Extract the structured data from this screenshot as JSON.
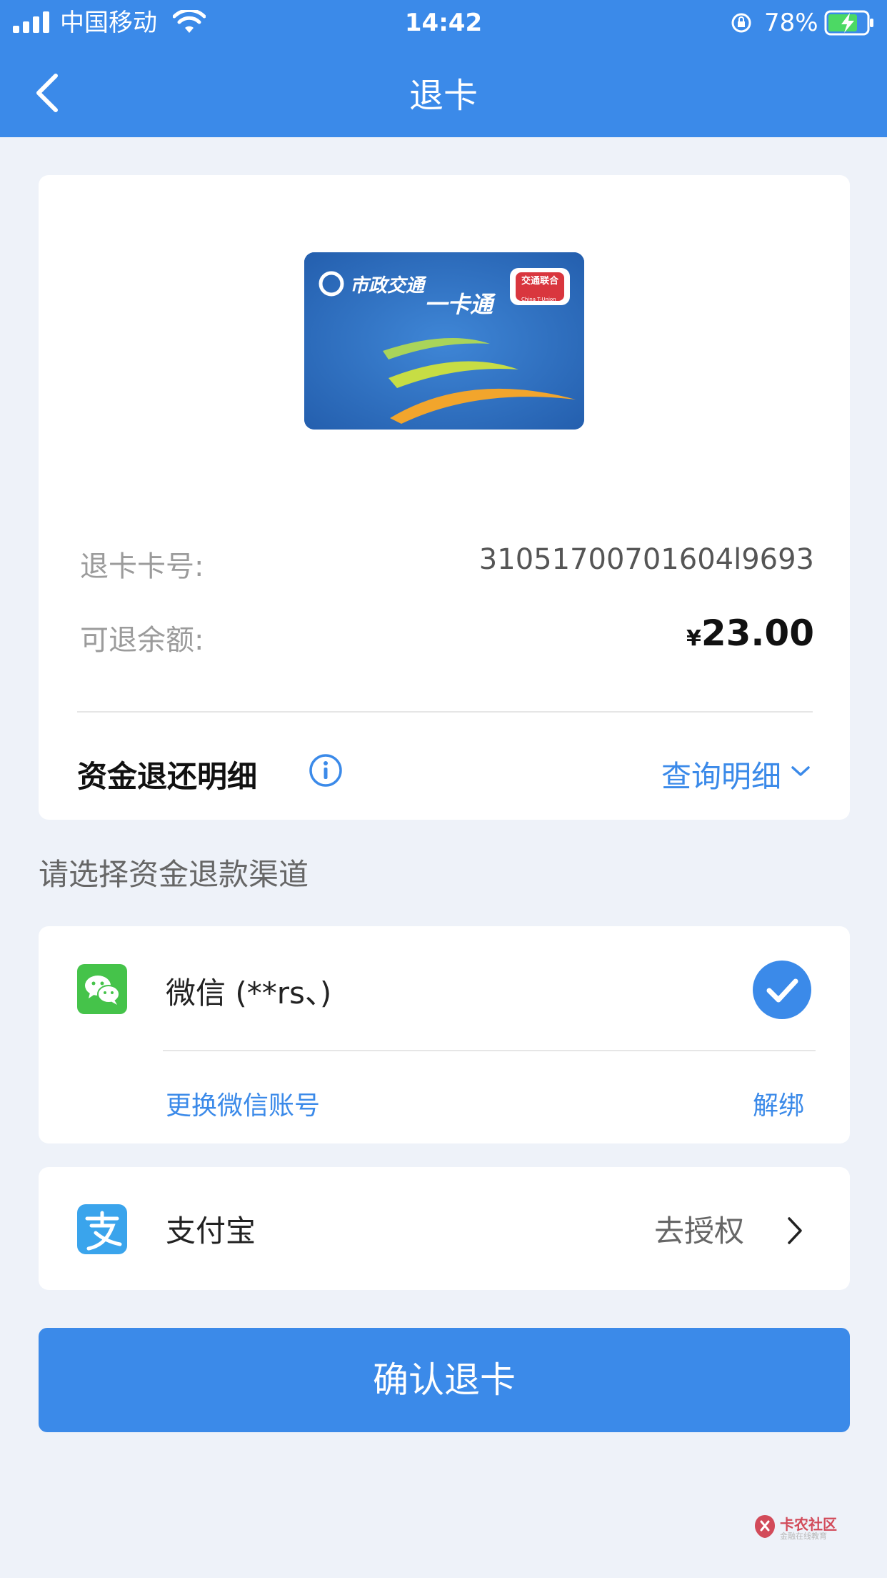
{
  "status_bar": {
    "carrier": "中国移动",
    "time": "14:42",
    "battery": "78%"
  },
  "nav": {
    "title": "退卡"
  },
  "card_image": {
    "logo_text": "市政交通",
    "brand_text": "一卡通",
    "badge_text": "交通联合",
    "badge_sub": "China T-Union"
  },
  "refund_info": {
    "card_no_label": "退卡卡号:",
    "card_no": "31051700701604l9693",
    "balance_label": "可退余额:",
    "currency": "¥",
    "balance": "23.00"
  },
  "refund_detail": {
    "title": "资金退还明细",
    "link": "查询明细"
  },
  "channel_section": {
    "label": "请选择资金退款渠道"
  },
  "wechat": {
    "name": "微信 (**rs、)",
    "change_account": "更换微信账号",
    "unbind": "解绑"
  },
  "alipay": {
    "name": "支付宝",
    "action": "去授权"
  },
  "confirm_button": {
    "label": "确认退卡"
  },
  "watermark": {
    "text": "卡农社区",
    "sub": "金融在线教育"
  },
  "colors": {
    "primary": "#3b8ae9",
    "wechat_green": "#45c34a",
    "alipay_blue": "#3aa4ec",
    "background": "#eef2f9"
  }
}
